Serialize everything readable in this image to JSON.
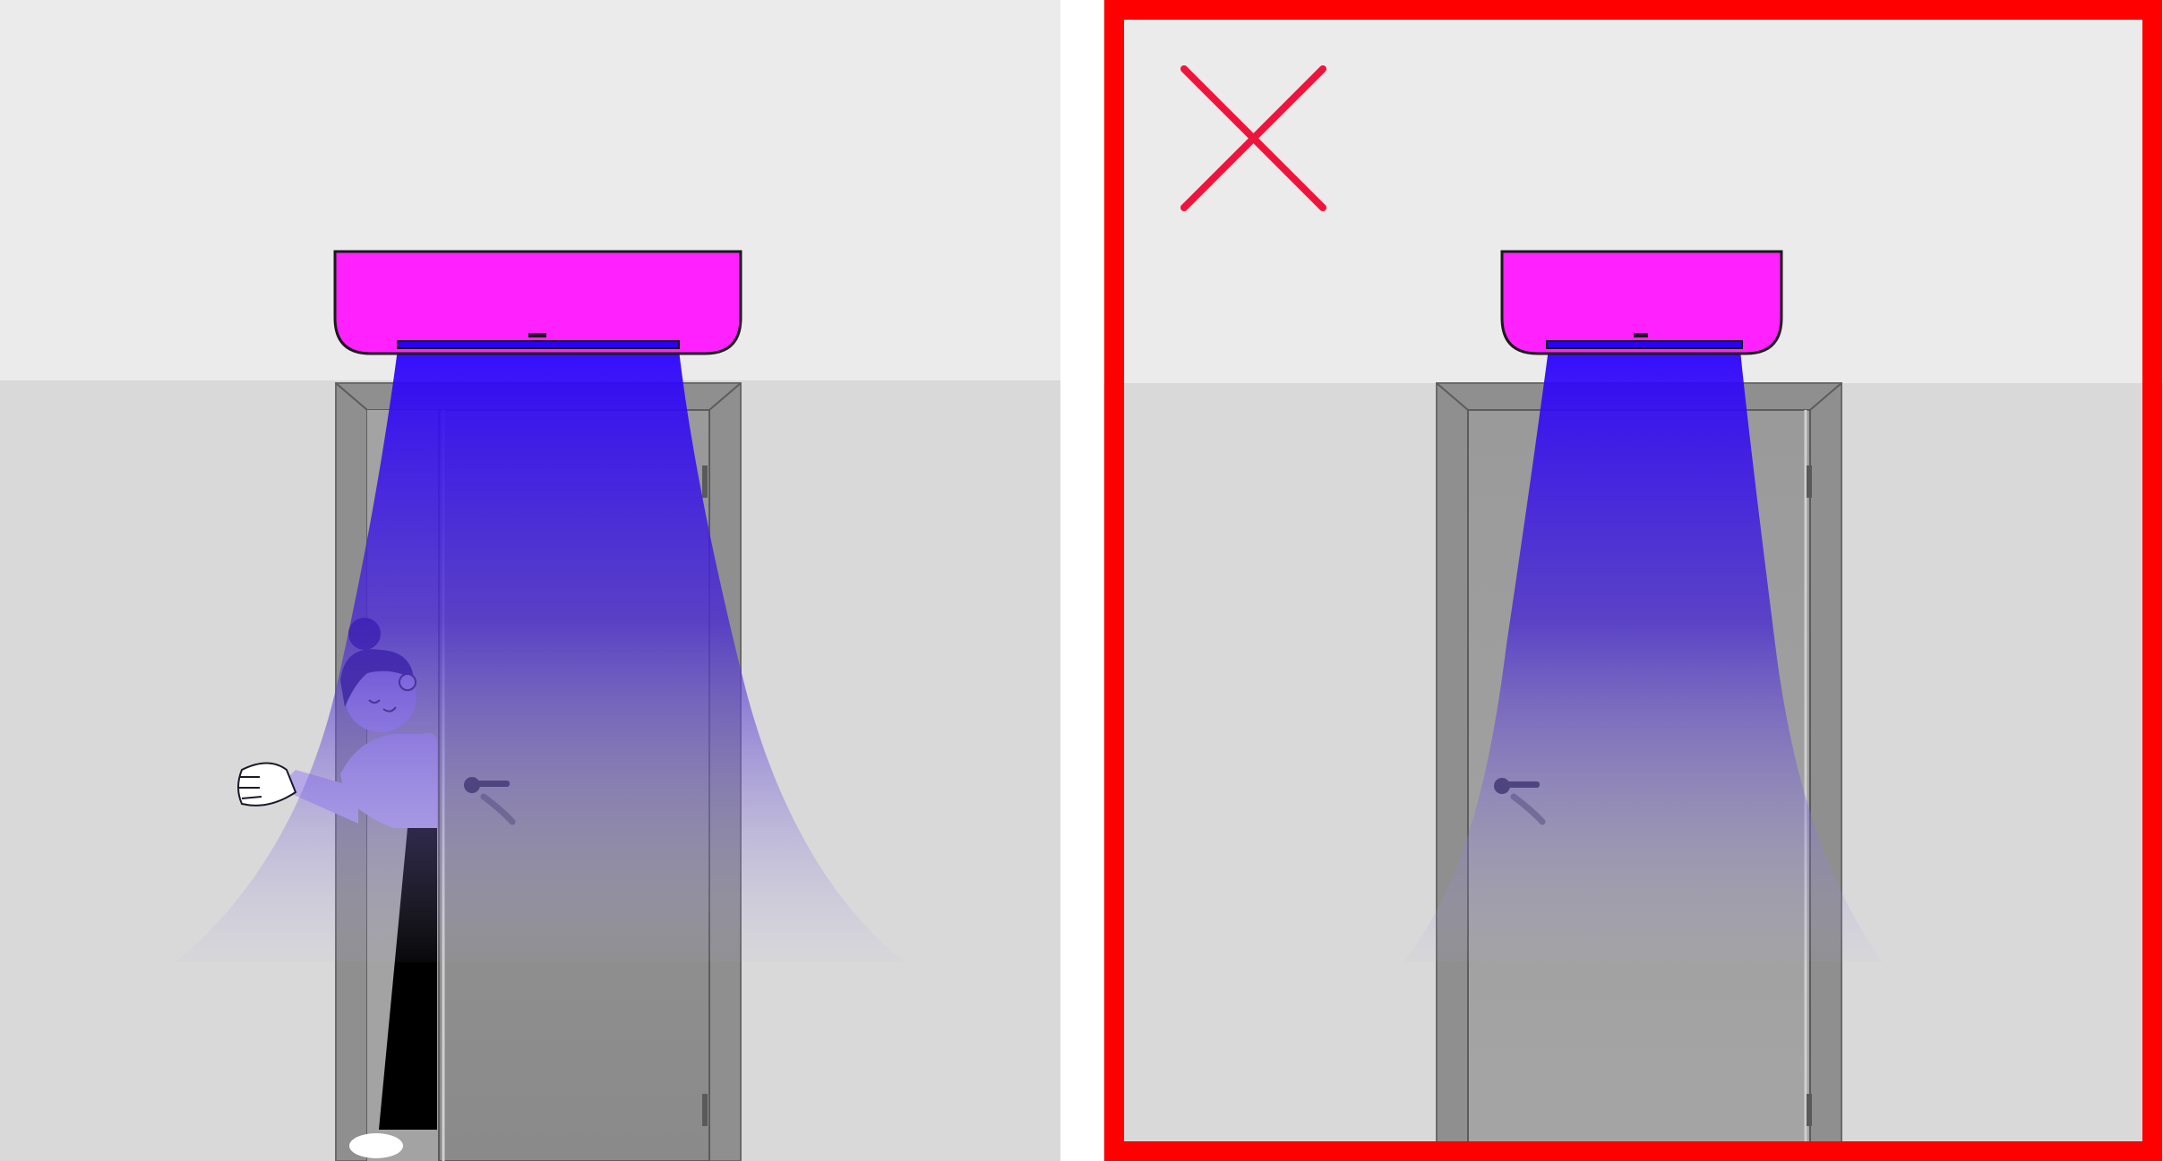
{
  "panels": [
    {
      "id": "left",
      "status": "correct",
      "door_state": "open",
      "person_present": true,
      "curtain_spread": "wide"
    },
    {
      "id": "right",
      "status": "incorrect",
      "door_state": "closed",
      "person_present": false,
      "curtain_spread": "narrow",
      "marker_icon": "cross-icon",
      "frame_color": "#ff0000",
      "marker_color": "#f0143c"
    }
  ],
  "colors": {
    "ceiling": "#ebebeb",
    "wall": "#d9d9d9",
    "door": "#999999",
    "door_frame": "#8c8c8c",
    "heater_unit": "#ff22ff",
    "air_stream_top": "#2a00ff",
    "air_stream_bottom": "#b4b4c8",
    "person_skin": "#b3a3e8",
    "person_hair": "#1a0a5a"
  }
}
